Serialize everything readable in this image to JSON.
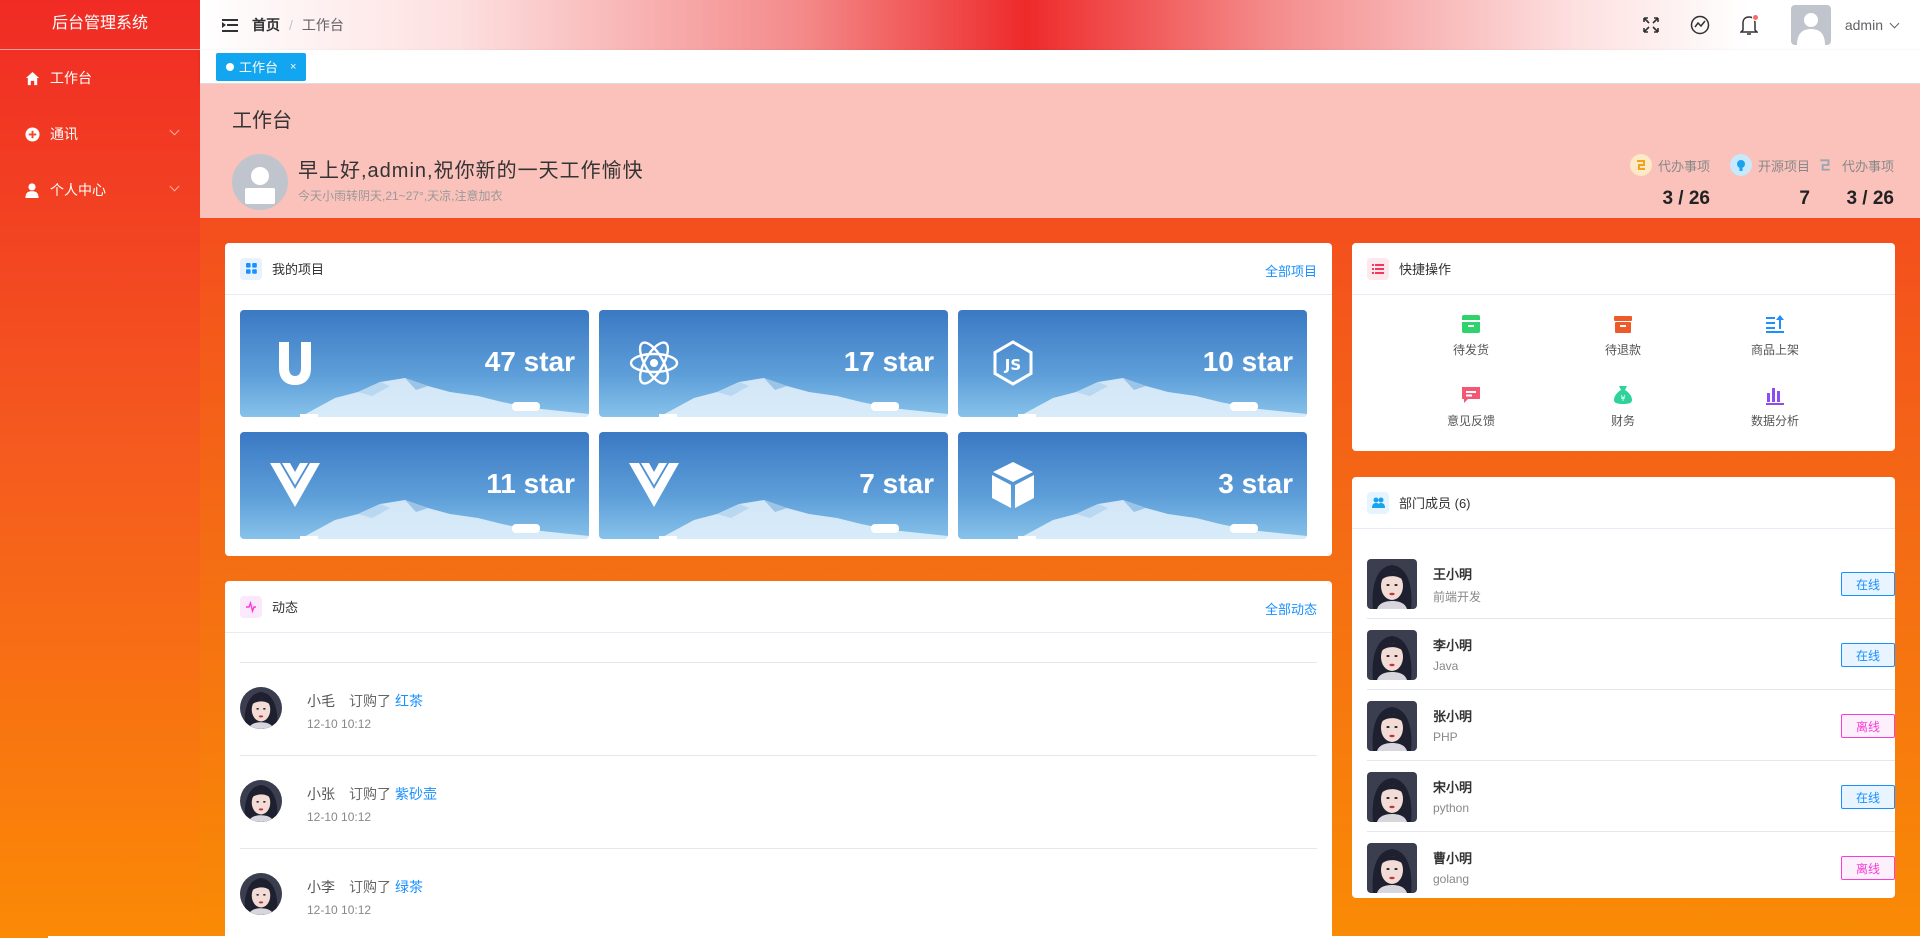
{
  "app": {
    "title": "后台管理系统"
  },
  "sidebar": {
    "items": [
      {
        "label": "工作台",
        "icon": "home-icon"
      },
      {
        "label": "通讯",
        "icon": "plus-circle-icon"
      },
      {
        "label": "个人中心",
        "icon": "user-icon"
      }
    ]
  },
  "navbar": {
    "breadcrumb": [
      "首页",
      "工作台"
    ],
    "username": "admin",
    "icons": [
      "fullscreen-icon",
      "chart-trend-icon",
      "bell-icon"
    ]
  },
  "tags": [
    {
      "label": "工作台",
      "close": "×"
    }
  ],
  "header": {
    "title": "工作台",
    "greeting": "早上好,admin,祝你新的一天工作愉快",
    "weather": "今天小雨转阴天,21~27°,天凉,注意加衣",
    "stats": [
      {
        "label": "代办事项",
        "value": "3 / 26",
        "color": "#f4a11e"
      },
      {
        "label": "开源项目",
        "value": "7",
        "color": "#1aa2f0"
      },
      {
        "label": "代办事项",
        "value": "3 / 26",
        "color": "#9aa4b4"
      }
    ]
  },
  "projects": {
    "title": "我的项目",
    "more": "全部项目",
    "items": [
      {
        "icon": "uni-app-icon",
        "stars": "47 star"
      },
      {
        "icon": "react-icon",
        "stars": "17 star"
      },
      {
        "icon": "nodejs-icon",
        "stars": "10 star"
      },
      {
        "icon": "vue-icon",
        "stars": "11 star"
      },
      {
        "icon": "vue-icon",
        "stars": "7 star"
      },
      {
        "icon": "cube-icon",
        "stars": "3 star"
      }
    ]
  },
  "quick": {
    "title": "快捷操作",
    "items": [
      {
        "label": "待发货",
        "color": "#2ed36b"
      },
      {
        "label": "待退款",
        "color": "#ef5a2a"
      },
      {
        "label": "商品上架",
        "color": "#1e8ffc"
      },
      {
        "label": "意见反馈",
        "color": "#f35774"
      },
      {
        "label": "财务",
        "color": "#2ed39c"
      },
      {
        "label": "数据分析",
        "color": "#8c4ef2"
      }
    ]
  },
  "members": {
    "title": "部门成员 (6)",
    "items": [
      {
        "name": "王小明",
        "role": "前端开发",
        "status": "在线",
        "online": true
      },
      {
        "name": "李小明",
        "role": "Java",
        "status": "在线",
        "online": true
      },
      {
        "name": "张小明",
        "role": "PHP",
        "status": "离线",
        "online": false
      },
      {
        "name": "宋小明",
        "role": "python",
        "status": "在线",
        "online": true
      },
      {
        "name": "曹小明",
        "role": "golang",
        "status": "离线",
        "online": false
      }
    ]
  },
  "activity": {
    "title": "动态",
    "more": "全部动态",
    "items": [
      {
        "user": "小毛",
        "action": "订购了",
        "item": "红茶",
        "time": "12-10 10:12"
      },
      {
        "user": "小张",
        "action": "订购了",
        "item": "紫砂壶",
        "time": "12-10 10:12"
      },
      {
        "user": "小李",
        "action": "订购了",
        "item": "绿茶",
        "time": "12-10 10:12"
      }
    ]
  }
}
